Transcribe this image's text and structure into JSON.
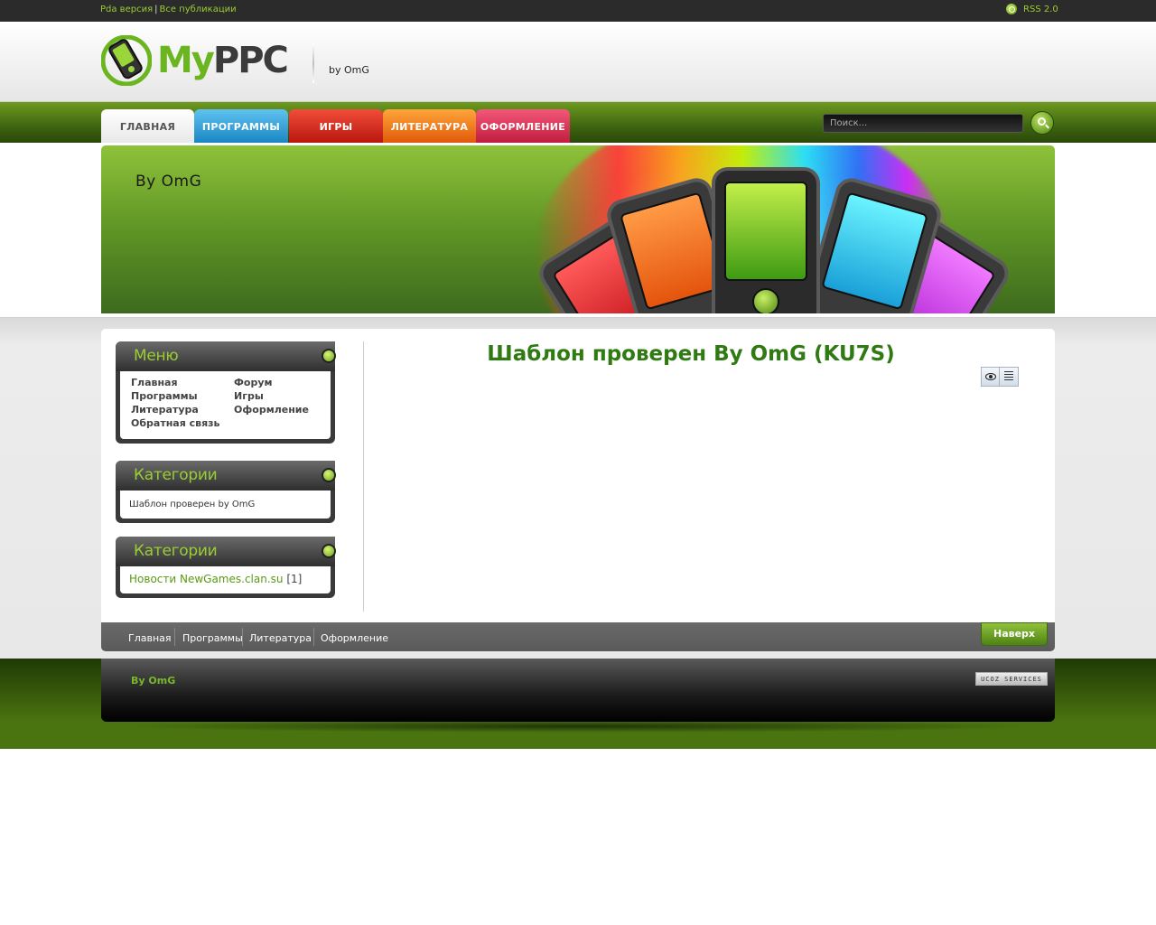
{
  "topbar": {
    "pda_link": "Pda версия",
    "separator": "|",
    "all_pubs_link": "Все публикации",
    "rss_label": "RSS 2.0"
  },
  "header": {
    "logo_my": "My",
    "logo_ppc": "PPC",
    "byline": "by OmG"
  },
  "nav": {
    "tabs": [
      {
        "label": "ГЛАВНАЯ",
        "color": "#f0f0f0"
      },
      {
        "label": "ПРОГРАММЫ",
        "color": "#1a86c3"
      },
      {
        "label": "ИГРЫ",
        "color": "#b8170e"
      },
      {
        "label": "ЛИТЕРАТУРА",
        "color": "#e0590a"
      },
      {
        "label": "ОФОРМЛЕНИЕ",
        "color": "#c11d3d"
      }
    ],
    "search_placeholder": "Поиск...",
    "search_icon": "magnifier-icon"
  },
  "banner": {
    "title": "By OmG"
  },
  "sidebar": {
    "menu": {
      "title": "Меню",
      "items": [
        "Главная",
        "Форум",
        "Программы",
        "Игры",
        "Литература",
        "Оформление",
        "Обратная связь"
      ]
    },
    "categories1": {
      "title": "Категории",
      "item": "Шаблон проверен by OmG"
    },
    "categories2": {
      "title": "Категории",
      "link": "Новости NewGames.clan.su",
      "count": "[1]"
    }
  },
  "main": {
    "title": "Шаблон проверен By OmG (KU7S)",
    "icons": [
      "eye-icon",
      "list-icon"
    ]
  },
  "footer_menu": {
    "items": [
      "Главная",
      "Программы",
      "Литература",
      "Оформление"
    ],
    "up_button": "Наверх"
  },
  "bottom": {
    "copyright": "By OmG",
    "ucoz_badge": "UCOZ SERVICES"
  },
  "colors": {
    "accent_green": "#6bb620",
    "title_green": "#2f7a12",
    "dark_bar": "#2b2b2b"
  }
}
